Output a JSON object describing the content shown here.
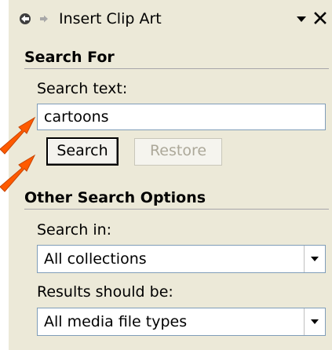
{
  "pane": {
    "title": "Insert Clip Art",
    "icons": {
      "back": "back-arrow-icon",
      "forward": "forward-arrow-icon",
      "menu": "triangle-down-icon",
      "close": "close-icon"
    }
  },
  "search_for": {
    "heading": "Search For",
    "search_text_label": "Search text:",
    "search_text_value": "cartoons",
    "search_button": "Search",
    "restore_button": "Restore"
  },
  "other_options": {
    "heading": "Other Search Options",
    "search_in_label": "Search in:",
    "search_in_value": "All collections",
    "results_label": "Results should be:",
    "results_value": "All media file types"
  },
  "colors": {
    "pane_bg": "#ece9d8",
    "annotation_arrow": "#ff5a00"
  }
}
